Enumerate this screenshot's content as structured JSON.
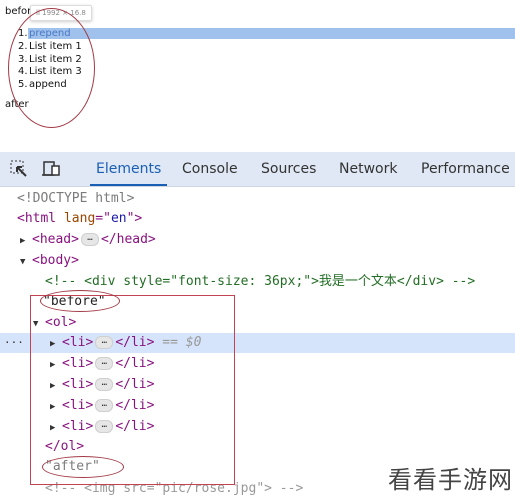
{
  "preview": {
    "before_text": "before",
    "tooltip": "li  1992 × 16.8",
    "list_items": [
      {
        "num": "1.",
        "label": "prepend",
        "highlighted": true
      },
      {
        "num": "2.",
        "label": "List item 1"
      },
      {
        "num": "3.",
        "label": "List item 2"
      },
      {
        "num": "4.",
        "label": "List item 3"
      },
      {
        "num": "5.",
        "label": "append"
      }
    ],
    "after_text": "after"
  },
  "devtools": {
    "toolbar": {
      "inspect_icon": "inspect-element-icon",
      "device_icon": "device-toolbar-icon",
      "tabs": [
        {
          "label": "Elements",
          "active": true
        },
        {
          "label": "Console"
        },
        {
          "label": "Sources"
        },
        {
          "label": "Network"
        },
        {
          "label": "Performance"
        }
      ]
    },
    "tree": {
      "doctype": "<!DOCTYPE html>",
      "html_open_tag": "<html ",
      "html_attr_name": "lang",
      "html_attr_eq": "=\"",
      "html_attr_value": "en",
      "html_attr_close": "\">",
      "head": {
        "open": "<head>",
        "close": "</head>"
      },
      "body_open": "<body>",
      "comment_1": "<!-- <div style=\"font-size: 36px;\">我是一个文本</div> -->",
      "text_before": "\"before\"",
      "ol_open": "<ol>",
      "li_open": "<li>",
      "li_close": "</li>",
      "li_count": 5,
      "selected_marker": "== $0",
      "ol_close": "</ol>",
      "text_after": "\"after\"",
      "comment_2": "<!-- <img src=\"pic/rose.jpg\"> -->",
      "ellipsis": "…",
      "gutter_dots": "···"
    }
  },
  "watermark": "看看手游网"
}
